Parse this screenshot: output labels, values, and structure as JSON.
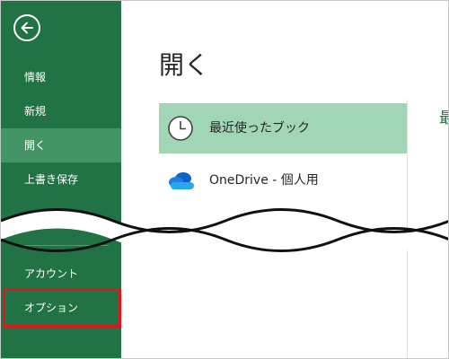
{
  "sidebar": {
    "back_icon": "arrow-left-circle-icon",
    "items": [
      {
        "label": "情報"
      },
      {
        "label": "新規"
      },
      {
        "label": "開く"
      },
      {
        "label": "上書き保存"
      },
      {
        "label": "アカウント"
      },
      {
        "label": "オプション"
      }
    ],
    "selected_index": 2,
    "highlighted_index": 5,
    "background_color": "#217346",
    "selected_color": "#439467",
    "highlight_color": "#e0141b"
  },
  "main": {
    "title": "開く",
    "locations": [
      {
        "label": "最近使ったブック",
        "icon": "clock-icon",
        "selected": true
      },
      {
        "label": "OneDrive - 個人用",
        "icon": "onedrive-cloud-icon",
        "selected": false
      }
    ],
    "right_peek": "最",
    "selected_bg_color": "#a0d6b5"
  }
}
